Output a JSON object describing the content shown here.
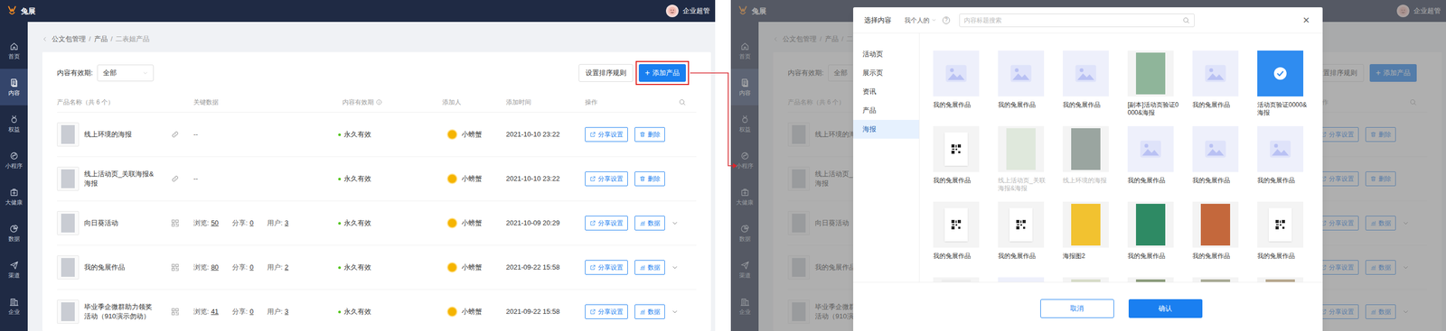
{
  "header": {
    "logo": "兔展",
    "user": "企业超管"
  },
  "sidebar": {
    "items": [
      {
        "label": "首页",
        "selected": false
      },
      {
        "label": "内容",
        "selected": true
      },
      {
        "label": "权益",
        "selected": false
      },
      {
        "label": "小程序",
        "selected": false
      },
      {
        "label": "大健康",
        "selected": false
      },
      {
        "label": "数据",
        "selected": false
      },
      {
        "label": "渠道",
        "selected": false
      },
      {
        "label": "企业",
        "selected": false
      }
    ]
  },
  "breadcrumb": {
    "items": [
      "公文包管理",
      "产品",
      "二表姐产品"
    ],
    "separator": "/"
  },
  "filter": {
    "label": "内容有效期:",
    "value": "全部"
  },
  "toolbar": {
    "sort_button": "设置排序规则",
    "add_button": {
      "icon": "+",
      "label": "添加产品"
    }
  },
  "table": {
    "columns": [
      "产品名称（共 6 个）",
      "关键数据",
      "内容有效期",
      "添加人",
      "添加时间",
      "操作"
    ],
    "rows": [
      {
        "name": "线上环境的海报",
        "kind": "link",
        "key_data": "--",
        "stats": [],
        "validity": "永久有效",
        "creator": "小螃蟹",
        "time": "2021-10-10 23:22",
        "actions": [
          {
            "label": "分享设置",
            "kind": "share"
          },
          {
            "label": "删除",
            "kind": "delete"
          }
        ],
        "expandable": false
      },
      {
        "name": "线上活动页_关联海报&海报",
        "kind": "link",
        "key_data": "--",
        "stats": [],
        "validity": "永久有效",
        "creator": "小螃蟹",
        "time": "2021-10-10 23:22",
        "actions": [
          {
            "label": "分享设置",
            "kind": "share"
          },
          {
            "label": "删除",
            "kind": "delete"
          }
        ],
        "expandable": false
      },
      {
        "name": "向日葵活动",
        "kind": "qrcode",
        "stats": [
          {
            "label": "浏览:",
            "value": "50"
          },
          {
            "label": "分享:",
            "value": "0"
          },
          {
            "label": "用户:",
            "value": "3"
          }
        ],
        "validity": "永久有效",
        "creator": "小螃蟹",
        "time": "2021-10-09 20:29",
        "actions": [
          {
            "label": "分享设置",
            "kind": "share"
          },
          {
            "label": "数据",
            "kind": "data"
          }
        ],
        "expandable": true
      },
      {
        "name": "我的兔展作品",
        "kind": "qrcode",
        "stats": [
          {
            "label": "浏览:",
            "value": "80"
          },
          {
            "label": "分享:",
            "value": "0"
          },
          {
            "label": "用户:",
            "value": "2"
          }
        ],
        "validity": "永久有效",
        "creator": "小螃蟹",
        "time": "2021-09-22 15:58",
        "actions": [
          {
            "label": "分享设置",
            "kind": "share"
          },
          {
            "label": "数据",
            "kind": "data"
          }
        ],
        "expandable": true
      },
      {
        "name": "毕业季企微群助力领奖活动（910演示勿动）",
        "kind": "qrcode",
        "stats": [
          {
            "label": "浏览:",
            "value": "41"
          },
          {
            "label": "分享:",
            "value": "0"
          },
          {
            "label": "用户:",
            "value": "3"
          }
        ],
        "validity": "永久有效",
        "creator": "小螃蟹",
        "time": "2021-09-22 15:58",
        "actions": [
          {
            "label": "分享设置",
            "kind": "share"
          },
          {
            "label": "数据",
            "kind": "data"
          }
        ],
        "expandable": true
      }
    ]
  },
  "annotation": {
    "highlighted": true,
    "arrow": true
  },
  "modal": {
    "title": "选择内容",
    "scope": "我个人的",
    "help": "?",
    "search_placeholder": "内容标题搜索",
    "close": "×",
    "categories": [
      {
        "label": "活动页",
        "selected": false
      },
      {
        "label": "展示页",
        "selected": false
      },
      {
        "label": "资讯",
        "selected": false
      },
      {
        "label": "产品",
        "selected": false
      },
      {
        "label": "海报",
        "selected": true
      }
    ],
    "items": [
      {
        "caption": "我的兔展作品",
        "kind": "placeholder",
        "selected": false,
        "disabled": false
      },
      {
        "caption": "我的兔展作品",
        "kind": "placeholder",
        "selected": false,
        "disabled": false
      },
      {
        "caption": "我的兔展作品",
        "kind": "placeholder",
        "selected": false,
        "disabled": false
      },
      {
        "caption": "[副本]活动页验证0000&海报",
        "kind": "image",
        "color": "#8fb59a",
        "selected": false,
        "disabled": false
      },
      {
        "caption": "我的兔展作品",
        "kind": "placeholder",
        "selected": false,
        "disabled": false
      },
      {
        "caption": "活动页验证0000&海报",
        "kind": "placeholder",
        "selected": true,
        "disabled": false
      },
      {
        "caption": "我的兔展作品",
        "kind": "qrcode",
        "selected": false,
        "disabled": false
      },
      {
        "caption": "线上活动页_关联海报&海报",
        "kind": "image",
        "color": "#dfe8dc",
        "selected": false,
        "disabled": true
      },
      {
        "caption": "线上环境的海报",
        "kind": "image",
        "color": "#9aa5a0",
        "selected": false,
        "disabled": true
      },
      {
        "caption": "我的兔展作品",
        "kind": "placeholder",
        "selected": false,
        "disabled": false
      },
      {
        "caption": "我的兔展作品",
        "kind": "placeholder",
        "selected": false,
        "disabled": false
      },
      {
        "caption": "我的兔展作品",
        "kind": "placeholder",
        "selected": false,
        "disabled": false
      },
      {
        "caption": "我的兔展作品",
        "kind": "qrcode",
        "selected": false,
        "disabled": false
      },
      {
        "caption": "我的兔展作品",
        "kind": "qrcode",
        "selected": false,
        "disabled": false
      },
      {
        "caption": "海报图2",
        "kind": "image",
        "color": "#f2c230",
        "selected": false,
        "disabled": false
      },
      {
        "caption": "我的兔展作品",
        "kind": "image",
        "color": "#2e8a64",
        "selected": false,
        "disabled": false
      },
      {
        "caption": "我的兔展作品",
        "kind": "image",
        "color": "#c4683c",
        "selected": false,
        "disabled": false
      },
      {
        "caption": "我的兔展作品",
        "kind": "qrcode",
        "selected": false,
        "disabled": false
      },
      {
        "kind": "image",
        "color": "#ededed",
        "selected": false
      },
      {
        "kind": "placeholder",
        "selected": false
      },
      {
        "kind": "image",
        "color": "#d7dcc8",
        "selected": false
      },
      {
        "kind": "image",
        "color": "#8c9c7c",
        "selected": false
      },
      {
        "kind": "image",
        "color": "#a9ab96",
        "selected": false
      },
      {
        "kind": "image",
        "color": "#b7a88e",
        "selected": false
      }
    ],
    "buttons": {
      "cancel": "取消",
      "confirm": "确认"
    }
  }
}
